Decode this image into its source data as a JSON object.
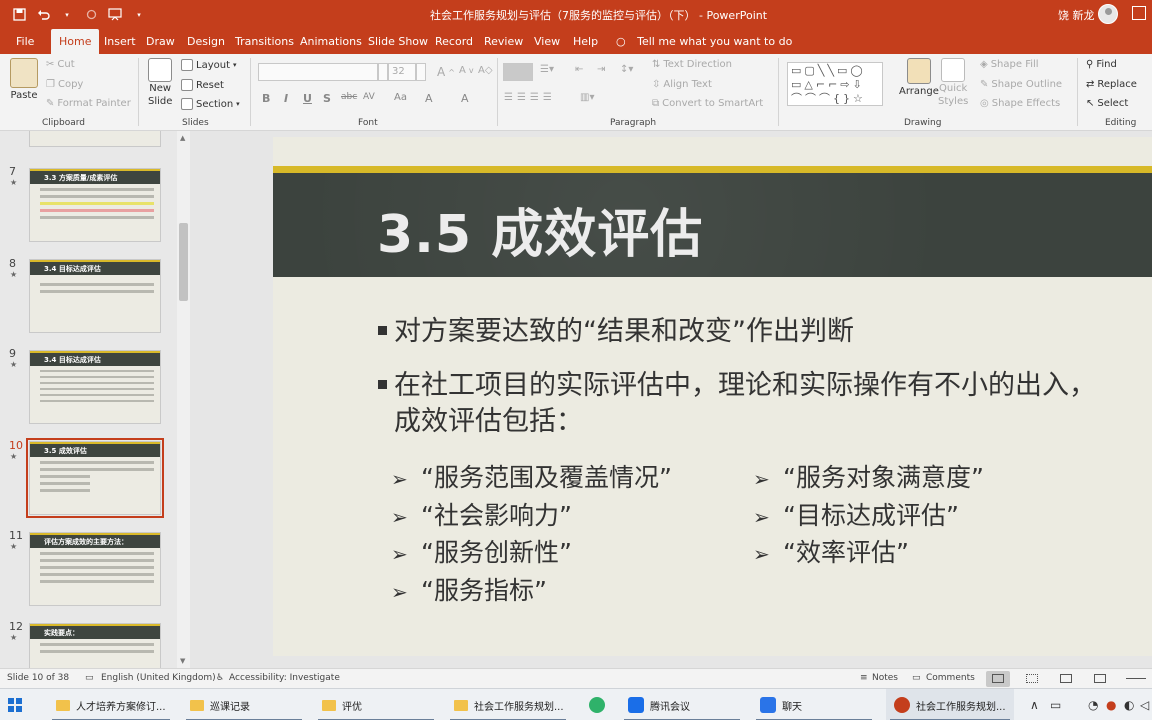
{
  "window": {
    "title": "社会工作服务规划与评估（7服务的监控与评估）（下） - PowerPoint",
    "user": "饶 新龙"
  },
  "quick_access": {
    "save_icon": "save-icon",
    "undo_icon": "undo-icon",
    "redo_icon": "redo-icon",
    "present_icon": "present-icon"
  },
  "tabs": [
    "File",
    "Home",
    "Insert",
    "Draw",
    "Design",
    "Transitions",
    "Animations",
    "Slide Show",
    "Record",
    "Review",
    "View",
    "Help"
  ],
  "active_tab": "Home",
  "tell_me": "Tell me what you want to do",
  "ribbon": {
    "clipboard": {
      "paste": "Paste",
      "cut": "Cut",
      "copy": "Copy",
      "format_painter": "Format Painter",
      "label": "Clipboard"
    },
    "slides": {
      "new_slide_line1": "New",
      "new_slide_line2": "Slide",
      "layout": "Layout",
      "reset": "Reset",
      "section": "Section",
      "label": "Slides"
    },
    "font": {
      "font_name": "",
      "font_size": "32",
      "format_buttons": [
        "B",
        "I",
        "U",
        "S",
        "abc",
        "AV",
        "Aa",
        "A",
        "A"
      ],
      "label": "Font"
    },
    "paragraph": {
      "text_direction": "Text Direction",
      "align_text": "Align Text",
      "convert_smartart": "Convert to SmartArt",
      "label": "Paragraph"
    },
    "drawing": {
      "shapes_preview": "▭▢╲╲▭◯ ▭△⌐⌐⇨⇩ ⌒⌒⌒{}☆",
      "arrange": "Arrange",
      "quick_styles_line1": "Quick",
      "quick_styles_line2": "Styles",
      "shape_fill": "Shape Fill",
      "shape_outline": "Shape Outline",
      "shape_effects": "Shape Effects",
      "label": "Drawing"
    },
    "editing": {
      "find": "Find",
      "replace": "Replace",
      "select": "Select",
      "label": "Editing"
    }
  },
  "thumbnails": [
    {
      "num": "7",
      "title": "3.3 方案质量/成素评估",
      "selected": false
    },
    {
      "num": "8",
      "title": "3.4 目标达成评估",
      "selected": false
    },
    {
      "num": "9",
      "title": "3.4 目标达成评估",
      "selected": false
    },
    {
      "num": "10",
      "title": "3.5 成效评估",
      "selected": true
    },
    {
      "num": "11",
      "title": "评估方案成效的主要方法：",
      "selected": false
    },
    {
      "num": "12",
      "title": "实践要点：",
      "selected": false
    }
  ],
  "slide": {
    "title": "3.5 成效评估",
    "bullets": [
      "对方案要达致的“结果和改变”作出判断",
      "在社工项目的实际评估中，理论和实际操作有不小的出入，成效评估包括："
    ],
    "sub_items_left": [
      "“服务范围及覆盖情况”",
      "“社会影响力”",
      "“服务创新性”",
      "“服务指标”"
    ],
    "sub_items_right": [
      "“服务对象满意度”",
      "“目标达成评估”",
      "“效率评估”"
    ],
    "arrow_glyph": "➢"
  },
  "status": {
    "slide_info": "Slide 10 of 38",
    "language": "English (United Kingdom)",
    "accessibility": "Accessibility: Investigate",
    "notes": "Notes",
    "comments": "Comments"
  },
  "taskbar": {
    "items": [
      {
        "label": "人才培养方案修订...",
        "icon": "folder-icon"
      },
      {
        "label": "巡课记录",
        "icon": "folder-icon"
      },
      {
        "label": "评优",
        "icon": "folder-icon"
      },
      {
        "label": "社会工作服务规划...",
        "icon": "folder-icon"
      },
      {
        "label": "腾讯会议",
        "icon": "tencent-meeting-icon"
      },
      {
        "label": "聊天",
        "icon": "chat-icon"
      },
      {
        "label": "社会工作服务规划...",
        "icon": "powerpoint-icon"
      }
    ]
  },
  "colors": {
    "accent": "#c43e1c",
    "slide_board": "#3c433e",
    "slide_gold": "#d7b928",
    "slide_bg": "#ecebe1"
  }
}
